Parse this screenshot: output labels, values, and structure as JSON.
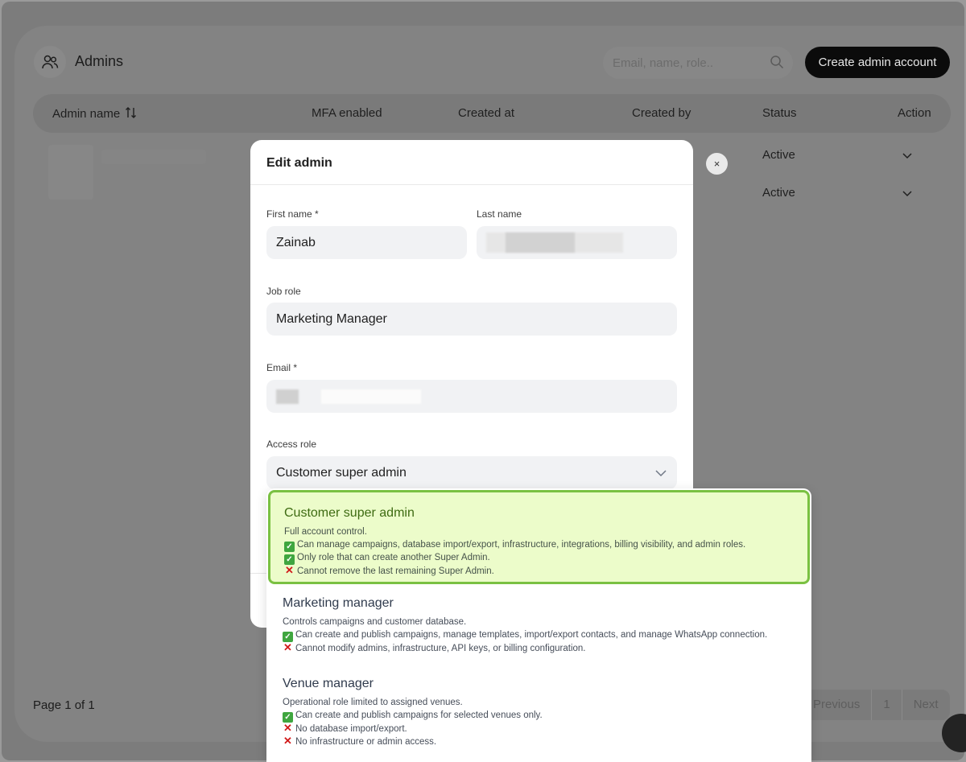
{
  "header": {
    "title": "Admins",
    "search_placeholder": "Email, name, role..",
    "create_button": "Create admin account"
  },
  "table": {
    "columns": [
      "Admin name",
      "MFA enabled",
      "Created at",
      "Created by",
      "Status",
      "Action"
    ],
    "rows": [
      {
        "status": "Active"
      },
      {
        "status": "Active"
      }
    ]
  },
  "footer": {
    "page_info": "Page 1 of 1",
    "previous": "Previous",
    "page": "1",
    "next": "Next"
  },
  "modal": {
    "title": "Edit admin",
    "close": "×",
    "first_name_label": "First name *",
    "first_name_value": "Zainab",
    "last_name_label": "Last name",
    "job_role_label": "Job role",
    "job_role_value": "Marketing Manager",
    "email_label": "Email *",
    "access_role_label": "Access role",
    "access_role_value": "Customer super admin"
  },
  "dropdown": {
    "options": [
      {
        "title": "Customer super admin",
        "desc": "Full account control.",
        "points": [
          {
            "kind": "ok",
            "text": "Can manage campaigns, database import/export, infrastructure, integrations, billing visibility, and admin roles."
          },
          {
            "kind": "ok",
            "text": "Only role that can create another Super Admin."
          },
          {
            "kind": "no",
            "text": "Cannot remove the last remaining Super Admin."
          }
        ]
      },
      {
        "title": "Marketing manager",
        "desc": "Controls campaigns and customer database.",
        "points": [
          {
            "kind": "ok",
            "text": "Can create and publish campaigns, manage templates, import/export contacts, and manage WhatsApp connection."
          },
          {
            "kind": "no",
            "text": "Cannot modify admins, infrastructure, API keys, or billing configuration."
          }
        ]
      },
      {
        "title": "Venue manager",
        "desc": "Operational role limited to assigned venues.",
        "points": [
          {
            "kind": "ok",
            "text": "Can create and publish campaigns for selected venues only."
          },
          {
            "kind": "no",
            "text": "No database import/export."
          },
          {
            "kind": "no",
            "text": "No infrastructure or admin access."
          }
        ]
      }
    ]
  },
  "colors": {
    "selected_bg": "#ecfcca",
    "selected_border": "#7ac142",
    "primary_button": "#0b0b0b"
  }
}
